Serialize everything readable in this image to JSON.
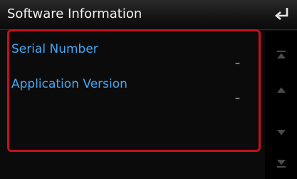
{
  "header": {
    "title": "Software Information",
    "back_icon": "return-arrow-icon"
  },
  "info_rows": [
    {
      "label": "Serial Number",
      "value": "–"
    },
    {
      "label": "Application Version",
      "value": "–"
    }
  ],
  "scroll": {
    "icons": [
      "scroll-to-top-icon",
      "scroll-up-icon",
      "scroll-down-icon",
      "scroll-to-bottom-icon"
    ]
  },
  "colors": {
    "label_blue": "#42a9f5",
    "focus_frame_red": "#c4101c",
    "background": "#0b0b0b"
  }
}
